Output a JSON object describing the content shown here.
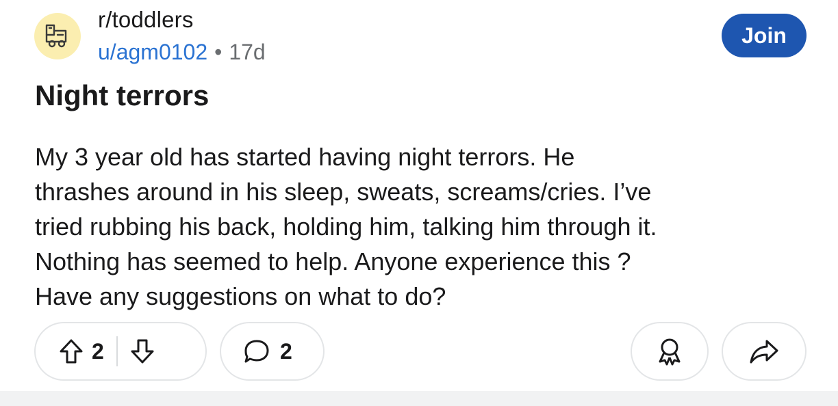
{
  "post": {
    "subreddit": "r/toddlers",
    "author": "u/agm0102",
    "separator": "•",
    "age": "17d",
    "join_label": "Join",
    "title": "Night terrors",
    "body_lines": [
      "My 3 year old has started having night terrors. He",
      "thrashes around in his sleep, sweats, screams/cries. I’ve",
      "tried rubbing his back, holding him, talking him through it.",
      "Nothing has seemed to help. Anyone experience this ?",
      "Have any suggestions on what to do?"
    ],
    "vote_count": "2",
    "comment_count": "2"
  },
  "icons": {
    "avatar": "toy-train-icon",
    "upvote": "arrow-up-outline-icon",
    "downvote": "arrow-down-outline-icon",
    "comment": "speech-bubble-icon",
    "award": "award-ribbon-icon",
    "share": "share-arrow-icon"
  },
  "colors": {
    "accent": "#1e56b0",
    "link": "#2b73d2",
    "avatar_bg": "#fbeeb0",
    "muted": "#6a6d70"
  }
}
